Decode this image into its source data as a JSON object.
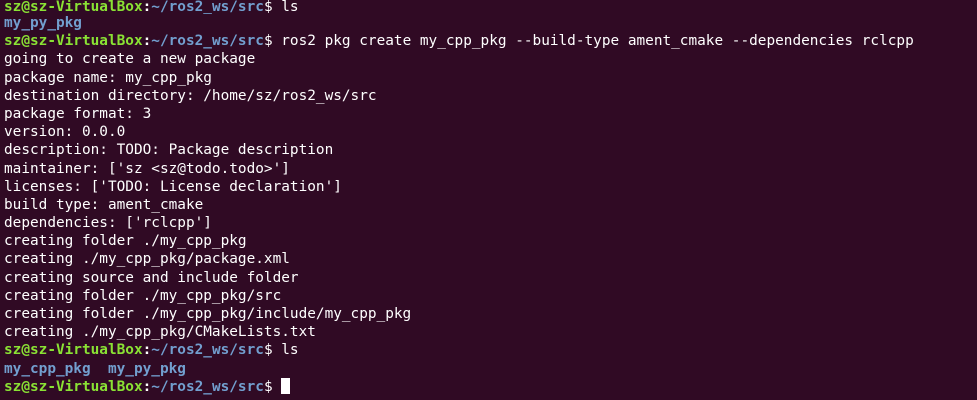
{
  "prompt": {
    "user_host": "sz@sz-VirtualBox",
    "colon": ":",
    "path": "~/ros2_ws/src",
    "dollar": "$"
  },
  "colors": {
    "background": "#300a24",
    "user_host": "#8ae234",
    "path": "#729fcf",
    "directory": "#729fcf",
    "text": "#ffffff"
  },
  "lines": {
    "l0": {
      "command": " ls"
    },
    "l1": {
      "dir": "my_py_pkg"
    },
    "l2": {
      "command": " ros2 pkg create my_cpp_pkg --build-type ament_cmake --dependencies rclcpp"
    },
    "l3": "going to create a new package",
    "l4": "package name: my_cpp_pkg",
    "l5": "destination directory: /home/sz/ros2_ws/src",
    "l6": "package format: 3",
    "l7": "version: 0.0.0",
    "l8": "description: TODO: Package description",
    "l9": "maintainer: ['sz <sz@todo.todo>']",
    "l10": "licenses: ['TODO: License declaration']",
    "l11": "build type: ament_cmake",
    "l12": "dependencies: ['rclcpp']",
    "l13": "creating folder ./my_cpp_pkg",
    "l14": "creating ./my_cpp_pkg/package.xml",
    "l15": "creating source and include folder",
    "l16": "creating folder ./my_cpp_pkg/src",
    "l17": "creating folder ./my_cpp_pkg/include/my_cpp_pkg",
    "l18": "creating ./my_cpp_pkg/CMakeLists.txt",
    "l19": {
      "command": " ls"
    },
    "l20": {
      "dirs": [
        "my_cpp_pkg",
        "my_py_pkg"
      ]
    },
    "l21": {
      "command": " "
    }
  }
}
